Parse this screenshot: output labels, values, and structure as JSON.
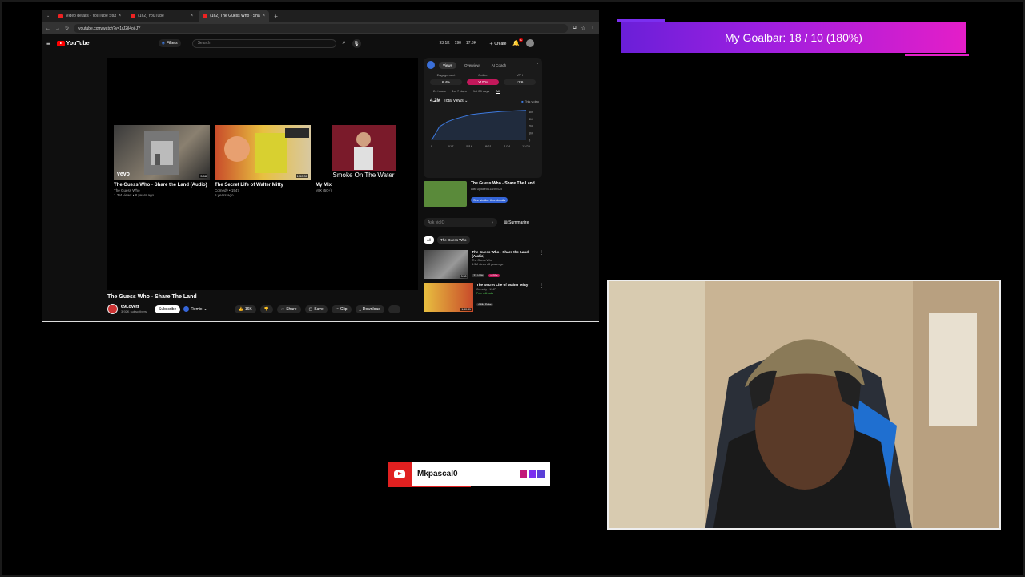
{
  "browser": {
    "tabs": [
      {
        "label": "Video details - YouTube Studio"
      },
      {
        "label": "(162) YouTube"
      },
      {
        "label": "(162) The Guess Who - Share T"
      }
    ],
    "url": "youtube.com/watch?v=1rJ2jl4oj-JY"
  },
  "youtube": {
    "logo": "YouTube",
    "filters_label": "Filters",
    "search_placeholder": "Search",
    "stats": [
      "93.1K",
      "190",
      "17.3K"
    ],
    "create_label": "Create",
    "notif_count": "9+"
  },
  "endcards": [
    {
      "title": "The Guess Who - Share the Land (Audio)",
      "meta1": "The Guess Who",
      "meta2": "1.3M views • 8 years ago",
      "duration": "3:58",
      "overlay": "vevo"
    },
    {
      "title": "The Secret Life of Walter Mitty",
      "meta1": "Comedy • 1947",
      "meta2": "5 years ago",
      "duration": "1:50:31",
      "overlay": ""
    },
    {
      "title": "My Mix",
      "meta1": "MIX (50+)",
      "meta2": "",
      "duration": "",
      "overlay": "Smoke On The Water"
    }
  ],
  "video": {
    "title": "The Guess Who - Share The Land",
    "channel": "69Lovett",
    "subscribers": "3.92K subscribers",
    "subscribe_label": "Subscribe",
    "remix_label": "Remix",
    "likes": "16K",
    "share_label": "Share",
    "save_label": "Save",
    "clip_label": "Clip",
    "download_label": "Download"
  },
  "panel": {
    "tabs": [
      "Views",
      "Overview",
      "AI Coach"
    ],
    "metrics": [
      {
        "label": "Engagement",
        "value": "6.4%"
      },
      {
        "label": "Outlier",
        "value": ">100x"
      },
      {
        "label": "VPH",
        "value": "12.6"
      }
    ],
    "ranges": [
      "24 hours",
      "1st 7 days",
      "1st 28 days",
      "All"
    ],
    "total_views": "4.2M",
    "views_dropdown": "Total views",
    "legend": "This video",
    "suggest_title": "The Guess Who - Share The Land",
    "suggest_meta": "Last Updated 11/19/2025",
    "suggest_button": "See similar thumbnails"
  },
  "chart_data": {
    "type": "line",
    "x": [
      "0",
      "2/17",
      "5/16",
      "8/21",
      "1/24",
      "12/25"
    ],
    "yticks": [
      "0",
      "1M",
      "2M",
      "3M",
      "4M"
    ],
    "series": [
      {
        "name": "This video",
        "values": [
          0,
          1.9,
          2.6,
          3.0,
          3.3,
          3.6,
          3.75,
          3.85,
          3.95,
          4.05,
          4.1,
          4.15,
          4.2
        ]
      }
    ],
    "ylim": [
      0,
      4.5
    ],
    "color": "#3d7ae0"
  },
  "ask": {
    "placeholder": "Ask vidIQ",
    "summarize_label": "Summarize"
  },
  "chips": [
    "All",
    "The Guess Who"
  ],
  "related": [
    {
      "title": "The Guess Who - Share the Land (Audio)",
      "channel": "The Guess Who",
      "meta": "1.3M views • 8 years ago",
      "tag1": "33 VPH",
      "tag2": ">100x",
      "duration": "3:58"
    },
    {
      "title": "The Secret Life of Walter Mitty",
      "channel": "Comedy • 1947",
      "meta": "Free with ads",
      "tag1": "4.6M Subs",
      "tag2": "",
      "duration": "1:50:31"
    }
  ],
  "goalbar": {
    "text": "My Goalbar:  18 / 10 (180%)"
  },
  "nametag": {
    "name": "Mkpascal0",
    "squares": [
      "#c2187a",
      "#7b2ff0",
      "#5a3fd8"
    ]
  }
}
